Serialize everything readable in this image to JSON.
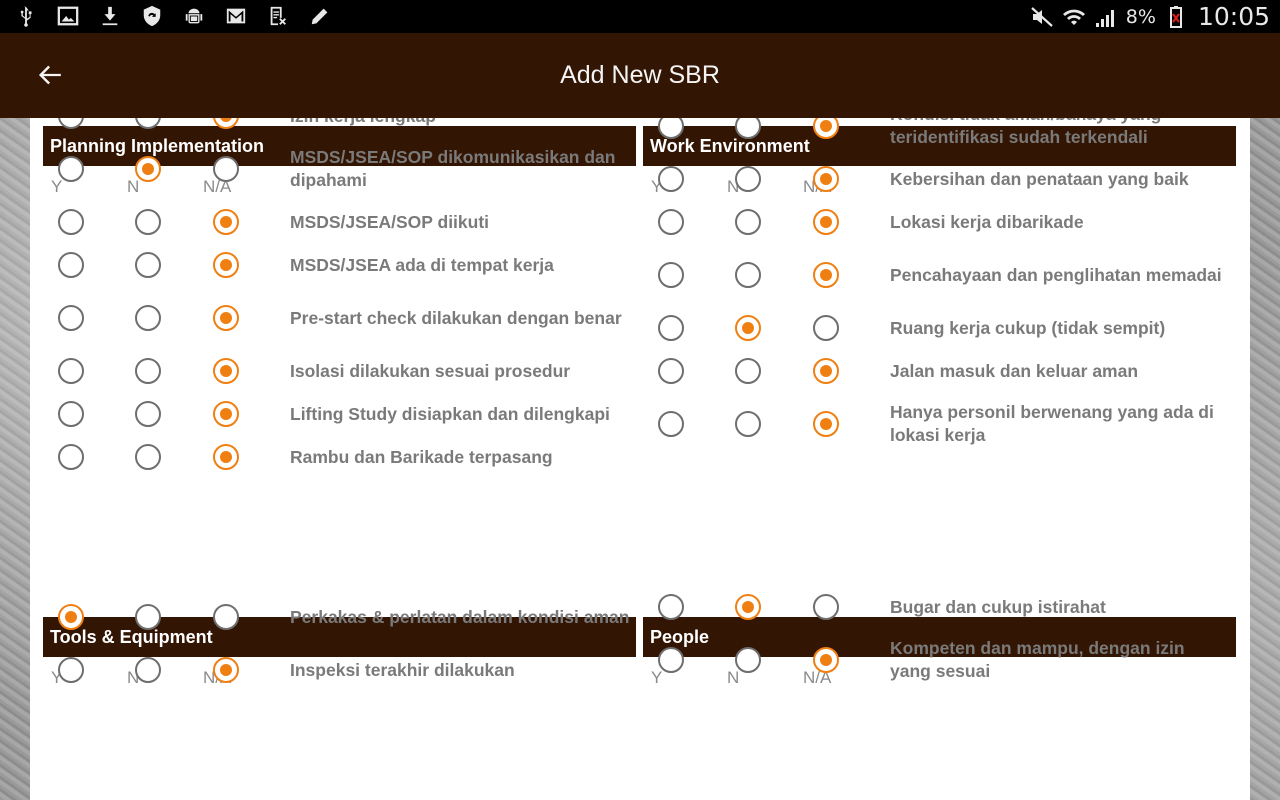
{
  "status_bar": {
    "left_icons": [
      "usb-icon",
      "image-icon",
      "download-icon",
      "shield-sync-icon",
      "android-debug-icon",
      "gmail-icon",
      "clipboard-icon",
      "edit-icon"
    ],
    "right_icons": [
      "mute-icon",
      "wifi-icon",
      "signal-icon",
      "battery-low-icon"
    ],
    "battery": "8%",
    "time": "10:05"
  },
  "app_bar": {
    "title": "Add New SBR",
    "back_icon": "arrow-back-icon"
  },
  "columns": {
    "y": "Y",
    "n": "N",
    "na": "N/A"
  },
  "colors": {
    "brand": "#331504",
    "accent": "#f07f12"
  },
  "sections": [
    {
      "title": "Planning Implementation",
      "items": [
        {
          "label": "Izin kerja lengkap",
          "selected": "N/A"
        },
        {
          "label": "MSDS/JSEA/SOP dikomunikasikan dan dipahami",
          "selected": "N"
        },
        {
          "label": "MSDS/JSEA/SOP diikuti",
          "selected": "N/A"
        },
        {
          "label": "MSDS/JSEA ada di tempat kerja",
          "selected": "N/A"
        },
        {
          "label": "Pre-start check dilakukan dengan benar",
          "selected": "N/A"
        },
        {
          "label": "Isolasi dilakukan sesuai prosedur",
          "selected": "N/A"
        },
        {
          "label": "Lifting Study disiapkan dan dilengkapi",
          "selected": "N/A"
        },
        {
          "label": "Rambu dan Barikade terpasang",
          "selected": "N/A"
        }
      ]
    },
    {
      "title": "Work Environment",
      "items": [
        {
          "label": "Kondisi tidak aman/bahaya yang teridentifikasi sudah terkendali",
          "selected": "N/A"
        },
        {
          "label": "Kebersihan dan penataan yang baik",
          "selected": "N/A"
        },
        {
          "label": "Lokasi kerja dibarikade",
          "selected": "N/A"
        },
        {
          "label": "Pencahayaan dan penglihatan memadai",
          "selected": "N/A"
        },
        {
          "label": "Ruang kerja cukup (tidak sempit)",
          "selected": "N"
        },
        {
          "label": "Jalan masuk dan keluar aman",
          "selected": "N/A"
        },
        {
          "label": "Hanya personil berwenang yang ada di lokasi kerja",
          "selected": "N/A"
        }
      ]
    },
    {
      "title": "Tools & Equipment",
      "items": [
        {
          "label": "Perkakas & perlatan dalam kondisi aman",
          "selected": "Y"
        },
        {
          "label": "Inspeksi terakhir dilakukan",
          "selected": "N/A"
        }
      ]
    },
    {
      "title": "People",
      "items": [
        {
          "label": "Bugar dan cukup istirahat",
          "selected": "N"
        },
        {
          "label": "Kompeten dan mampu, dengan izin yang sesuai",
          "selected": "N/A"
        }
      ]
    }
  ]
}
